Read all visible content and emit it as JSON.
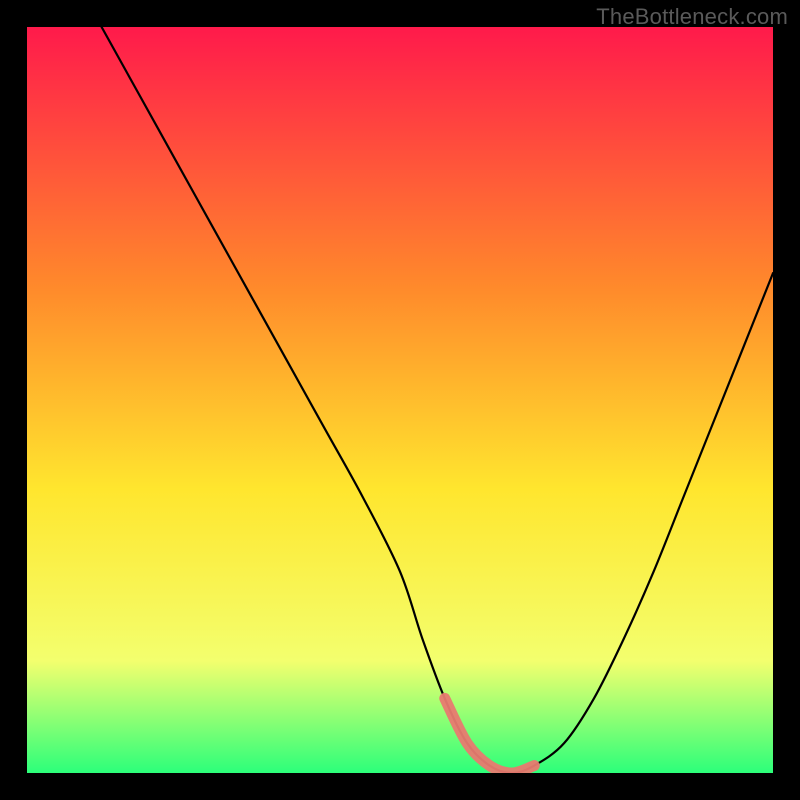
{
  "watermark": "TheBottleneck.com",
  "colors": {
    "gradient_top": "#ff1a4b",
    "gradient_upper_mid": "#ff8a2b",
    "gradient_mid": "#ffe62e",
    "gradient_lower_mid": "#f3ff6e",
    "gradient_bottom": "#2cff7a",
    "curve": "#000000",
    "highlight": "#e87a70",
    "frame": "#000000"
  },
  "chart_data": {
    "type": "line",
    "title": "",
    "xlabel": "",
    "ylabel": "",
    "xlim": [
      0,
      100
    ],
    "ylim": [
      0,
      100
    ],
    "series": [
      {
        "name": "bottleneck-curve",
        "x": [
          10,
          15,
          20,
          25,
          30,
          35,
          40,
          45,
          50,
          53,
          56,
          59,
          62,
          65,
          68,
          72,
          76,
          80,
          84,
          88,
          92,
          96,
          100
        ],
        "y": [
          100,
          91,
          82,
          73,
          64,
          55,
          46,
          37,
          27,
          18,
          10,
          4,
          1,
          0,
          1,
          4,
          10,
          18,
          27,
          37,
          47,
          57,
          67
        ]
      }
    ],
    "annotations": [
      {
        "name": "basin-highlight",
        "x_start": 56,
        "x_end": 71,
        "y": 2
      }
    ]
  }
}
